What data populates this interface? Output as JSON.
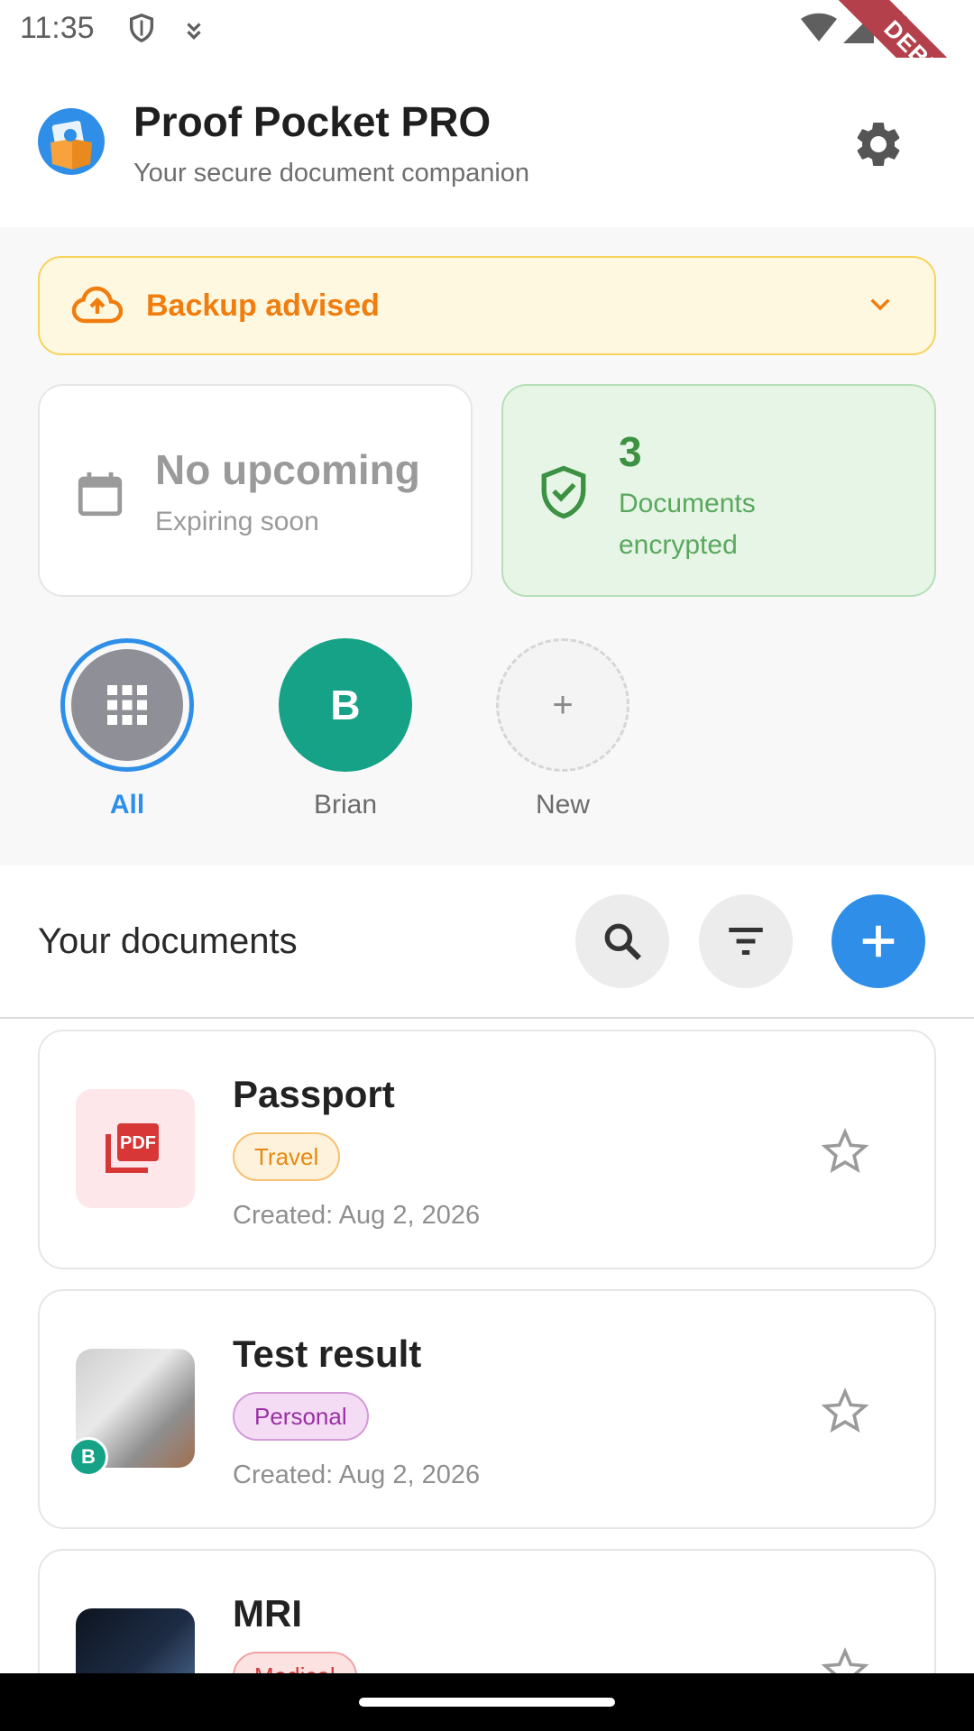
{
  "status_bar": {
    "time": "11:35",
    "debug_label": "DEBUG"
  },
  "header": {
    "title": "Proof Pocket PRO",
    "subtitle": "Your secure document companion",
    "settings_icon": "gear-icon"
  },
  "backup_banner": {
    "label": "Backup advised",
    "icon": "cloud-upload-icon",
    "accent": "#f07d0e"
  },
  "stats": {
    "expiring": {
      "title": "No upcoming",
      "subtitle": "Expiring soon"
    },
    "encrypted": {
      "count": "3",
      "label": "Documents encrypted"
    }
  },
  "profiles": [
    {
      "label": "All",
      "initial": ""
    },
    {
      "label": "Brian",
      "initial": "B"
    },
    {
      "label": "New",
      "initial": "+"
    }
  ],
  "documents": {
    "title": "Your documents",
    "items": [
      {
        "name": "Passport",
        "tag": "Travel",
        "created": "Created: Aug 2, 2026"
      },
      {
        "name": "Test result",
        "tag": "Personal",
        "created": "Created: Aug 2, 2026",
        "owner": "B"
      },
      {
        "name": "MRI",
        "tag": "Medical",
        "created": ""
      }
    ]
  },
  "colors": {
    "primary": "#2f8fe8",
    "profile_green": "#15a286",
    "warning_bg": "#fff8e1",
    "success_bg": "#e6f5e6"
  }
}
